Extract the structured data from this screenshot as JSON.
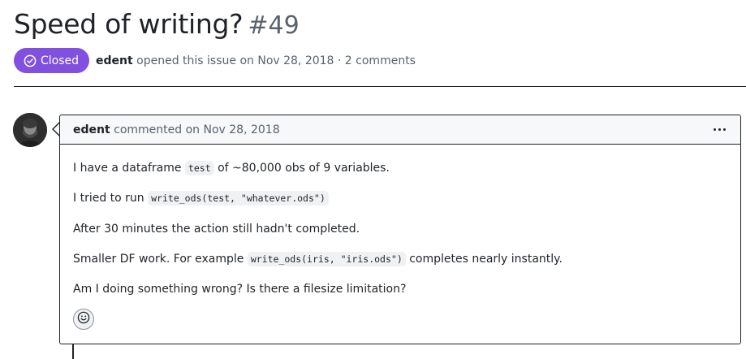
{
  "issue": {
    "title": "Speed of writing?",
    "number": "#49",
    "state": "Closed",
    "author": "edent",
    "opened_text": "opened this issue on Nov 28, 2018 · 2 comments"
  },
  "comment": {
    "author": "edent",
    "commented_text": "commented on Nov 28, 2018",
    "menu_icon": "kebab-horizontal-icon",
    "body": {
      "p1_before": "I have a dataframe",
      "p1_code": "test",
      "p1_after": "of ~80,000 obs of 9 variables.",
      "p2_before": "I tried to run",
      "p2_code": "write_ods(test, \"whatever.ods\")",
      "p3": "After 30 minutes the action still hadn't completed.",
      "p4_before": "Smaller DF work. For example",
      "p4_code": "write_ods(iris, \"iris.ods\")",
      "p4_after": "completes nearly instantly.",
      "p5": "Am I doing something wrong? Is there a filesize limitation?"
    },
    "reaction_icon": "smiley-icon"
  },
  "colors": {
    "closed_badge": "#8250df",
    "text": "#1f2328",
    "muted": "#59636e",
    "header_bg": "#f6f8fa",
    "code_bg": "#eff1f3"
  }
}
